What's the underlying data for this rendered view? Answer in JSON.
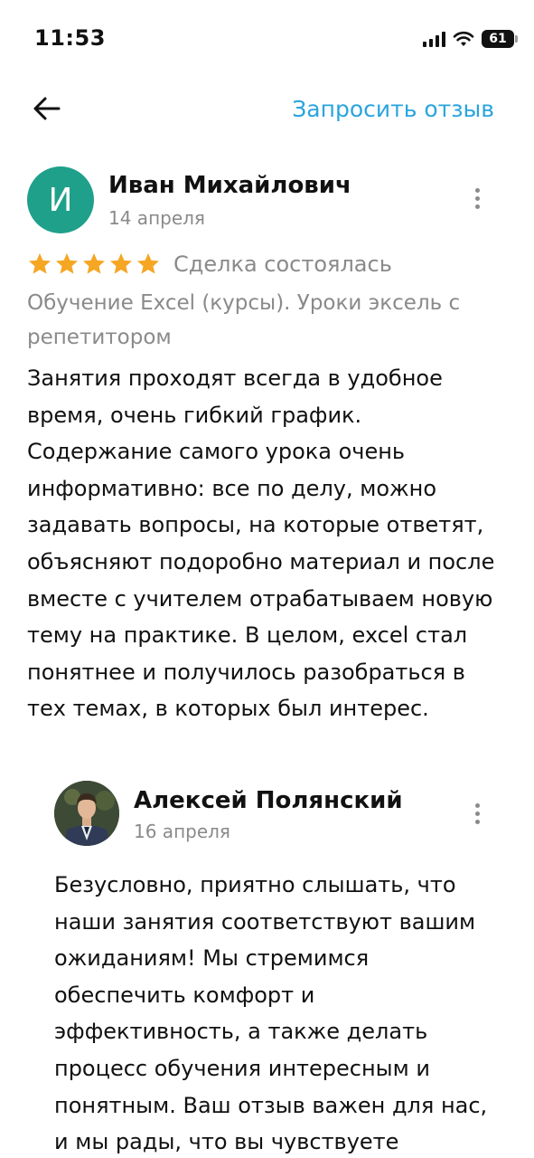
{
  "status_bar": {
    "time": "11:53",
    "battery": "61",
    "icons": [
      "signal-icon",
      "wifi-icon",
      "battery-icon"
    ]
  },
  "nav": {
    "back_icon": "arrow-left-icon",
    "request_review": "Запросить отзыв"
  },
  "review": {
    "avatar_initial": "И",
    "avatar_color": "#1fa08a",
    "author": "Иван Михайлович",
    "date": "14 апреля",
    "rating": 5,
    "star_color": "#f5a623",
    "deal_status": "Сделка состоялась",
    "service": "Обучение Excel (курсы). Уроки эксель с репетитором",
    "text": "Занятия проходят всегда в удобное время, очень гибкий график. Содержание самого урока очень информативно: все по делу, можно задавать вопросы, на которые ответят, объясняют подоробно материал и после вместе с учителем отрабатываем новую тему на практике. В целом, excel стал понятнее и получилось разобраться в тех темах, в которых был интерес."
  },
  "reply": {
    "author": "Алексей Полянский",
    "date": "16 апреля",
    "text": "Безусловно, приятно слышать, что наши занятия соответствуют вашим ожиданиям! Мы стремимся обеспечить комфорт и эффективность, а также делать процесс обучения интересным и понятным. Ваш отзыв важен для нас, и мы рады, что вы чувствуете"
  },
  "accent_color": "#2aa4df"
}
